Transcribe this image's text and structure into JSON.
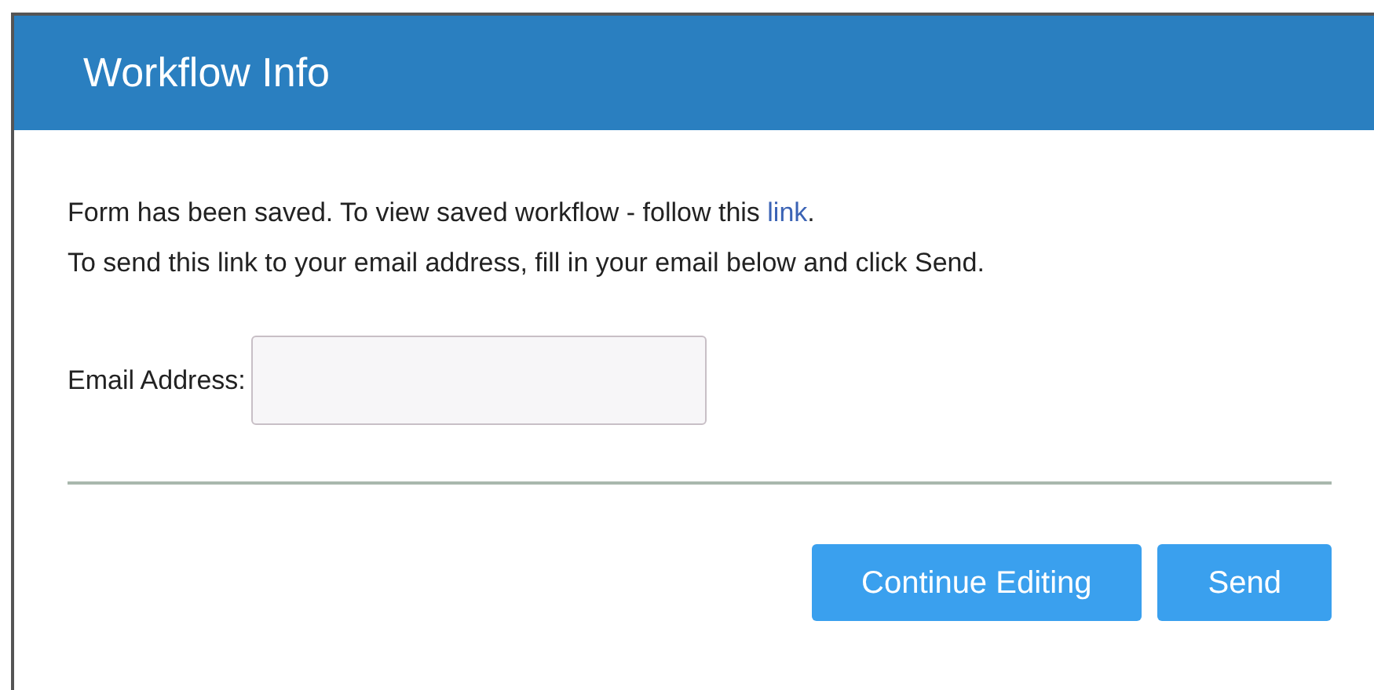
{
  "dialog": {
    "title": "Workflow Info",
    "message_lines": [
      {
        "text": "Form has been saved. To view saved workflow - follow this ",
        "link": "link",
        "after": "."
      },
      {
        "text": "To send this link to your email address, fill in your email below and click Send."
      }
    ],
    "email": {
      "label": "Email Address:"
    },
    "buttons": [
      "Continue Editing",
      "Send"
    ]
  }
}
